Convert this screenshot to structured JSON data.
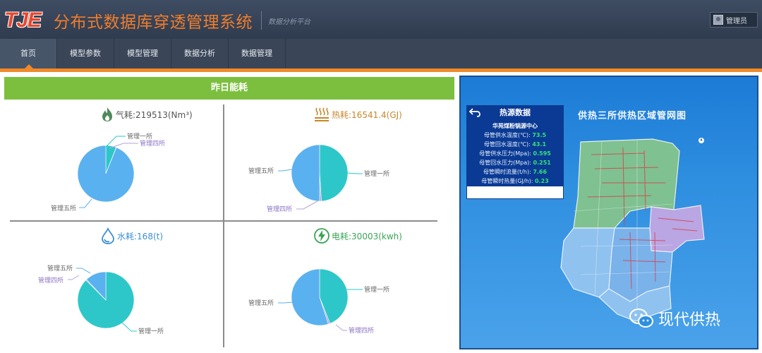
{
  "header": {
    "logo_text": "TJE",
    "title": "分布式数据库穿透管理系统",
    "subtitle": "数据分析平台",
    "user_label": "管理员"
  },
  "nav": {
    "items": [
      {
        "label": "首页",
        "active": true
      },
      {
        "label": "模型参数"
      },
      {
        "label": "模型管理"
      },
      {
        "label": "数据分析"
      },
      {
        "label": "数据管理"
      }
    ]
  },
  "energy": {
    "header": "昨日能耗",
    "colors": {
      "管理一所": "#2ec7c9",
      "管理四所": "#b6a2de",
      "管理五所": "#5ab1ef"
    },
    "gas": {
      "title": "气耗:219513(Nm³)",
      "color": "#555555",
      "icon": "flame-icon",
      "slices": [
        {
          "name": "管理一所",
          "value": 0.06
        },
        {
          "name": "管理四所",
          "value": 0.001
        },
        {
          "name": "管理五所",
          "value": 0.939
        }
      ]
    },
    "heat": {
      "title": "热耗:16541.4(GJ)",
      "color": "#c9862a",
      "icon": "heat-icon",
      "slices": [
        {
          "name": "管理一所",
          "value": 0.49
        },
        {
          "name": "管理四所",
          "value": 0.01
        },
        {
          "name": "管理五所",
          "value": 0.5
        }
      ]
    },
    "water": {
      "title": "水耗:168(t)",
      "color": "#3a8fd6",
      "icon": "water-drop-icon",
      "slices": [
        {
          "name": "管理一所",
          "value": 0.875
        },
        {
          "name": "管理四所",
          "value": 0.005
        },
        {
          "name": "管理五所",
          "value": 0.12
        }
      ]
    },
    "power": {
      "title": "电耗:30003(kwh)",
      "color": "#3aa556",
      "icon": "lightning-icon",
      "slices": [
        {
          "name": "管理一所",
          "value": 0.44
        },
        {
          "name": "管理四所",
          "value": 0.01
        },
        {
          "name": "管理五所",
          "value": 0.55
        }
      ]
    }
  },
  "map": {
    "title": "供热三所供热区域管网图",
    "heat_source": {
      "title": "热源数据",
      "station": "华苑煤粉锅源中心",
      "rows": [
        {
          "label": "母管供水温度(℃):",
          "value": "73.5"
        },
        {
          "label": "母管回水温度(℃):",
          "value": "43.1"
        },
        {
          "label": "母管供水压力(Mpa):",
          "value": "0.595"
        },
        {
          "label": "母管回水压力(Mpa):",
          "value": "0.251"
        },
        {
          "label": "母管瞬时流量(t/h):",
          "value": "7.66"
        },
        {
          "label": "母管瞬时热量(GJ/h):",
          "value": "0.23"
        }
      ]
    },
    "watermark": "现代供热"
  }
}
